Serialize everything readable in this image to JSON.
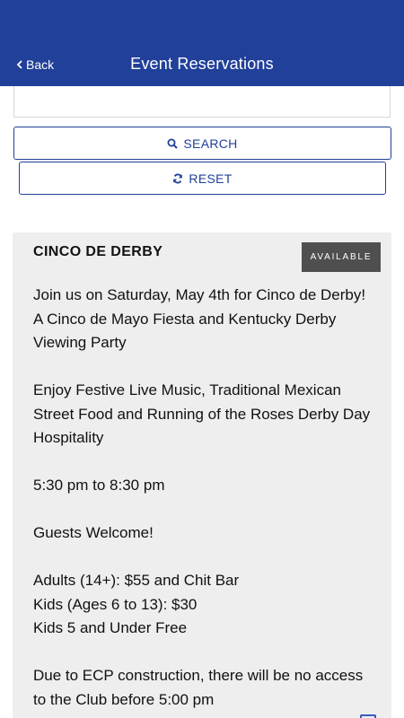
{
  "header": {
    "back_label": "Back",
    "title": "Event Reservations"
  },
  "search": {
    "value": "",
    "search_label": "SEARCH",
    "reset_label": "RESET"
  },
  "event": {
    "title": "CINCO DE DERBY",
    "status": "AVAILABLE",
    "paragraphs": [
      [
        "Join us on Saturday, May 4th for Cinco de Derby!",
        "A Cinco de Mayo Fiesta and Kentucky Derby",
        "Viewing Party"
      ],
      [
        "Enjoy Festive Live Music, Traditional Mexican",
        "Street Food and Running of the Roses Derby Day",
        "Hospitality"
      ],
      [
        "5:30 pm to 8:30 pm"
      ],
      [
        "Guests Welcome!"
      ],
      [
        "Adults (14+): $55 and Chit Bar",
        "Kids (Ages 6 to 13): $30",
        "Kids 5 and Under Free"
      ],
      [
        "Due to ECP construction, there will be no access",
        "to the Club before 5:00 pm"
      ]
    ]
  },
  "colors": {
    "header_bg": "#21409a",
    "accent": "#21409a",
    "badge_bg": "#4f4f4f",
    "card_bg": "#eeeeee"
  },
  "icons": {
    "back": "chevron-left-icon",
    "search": "search-icon",
    "reset": "refresh-icon"
  }
}
